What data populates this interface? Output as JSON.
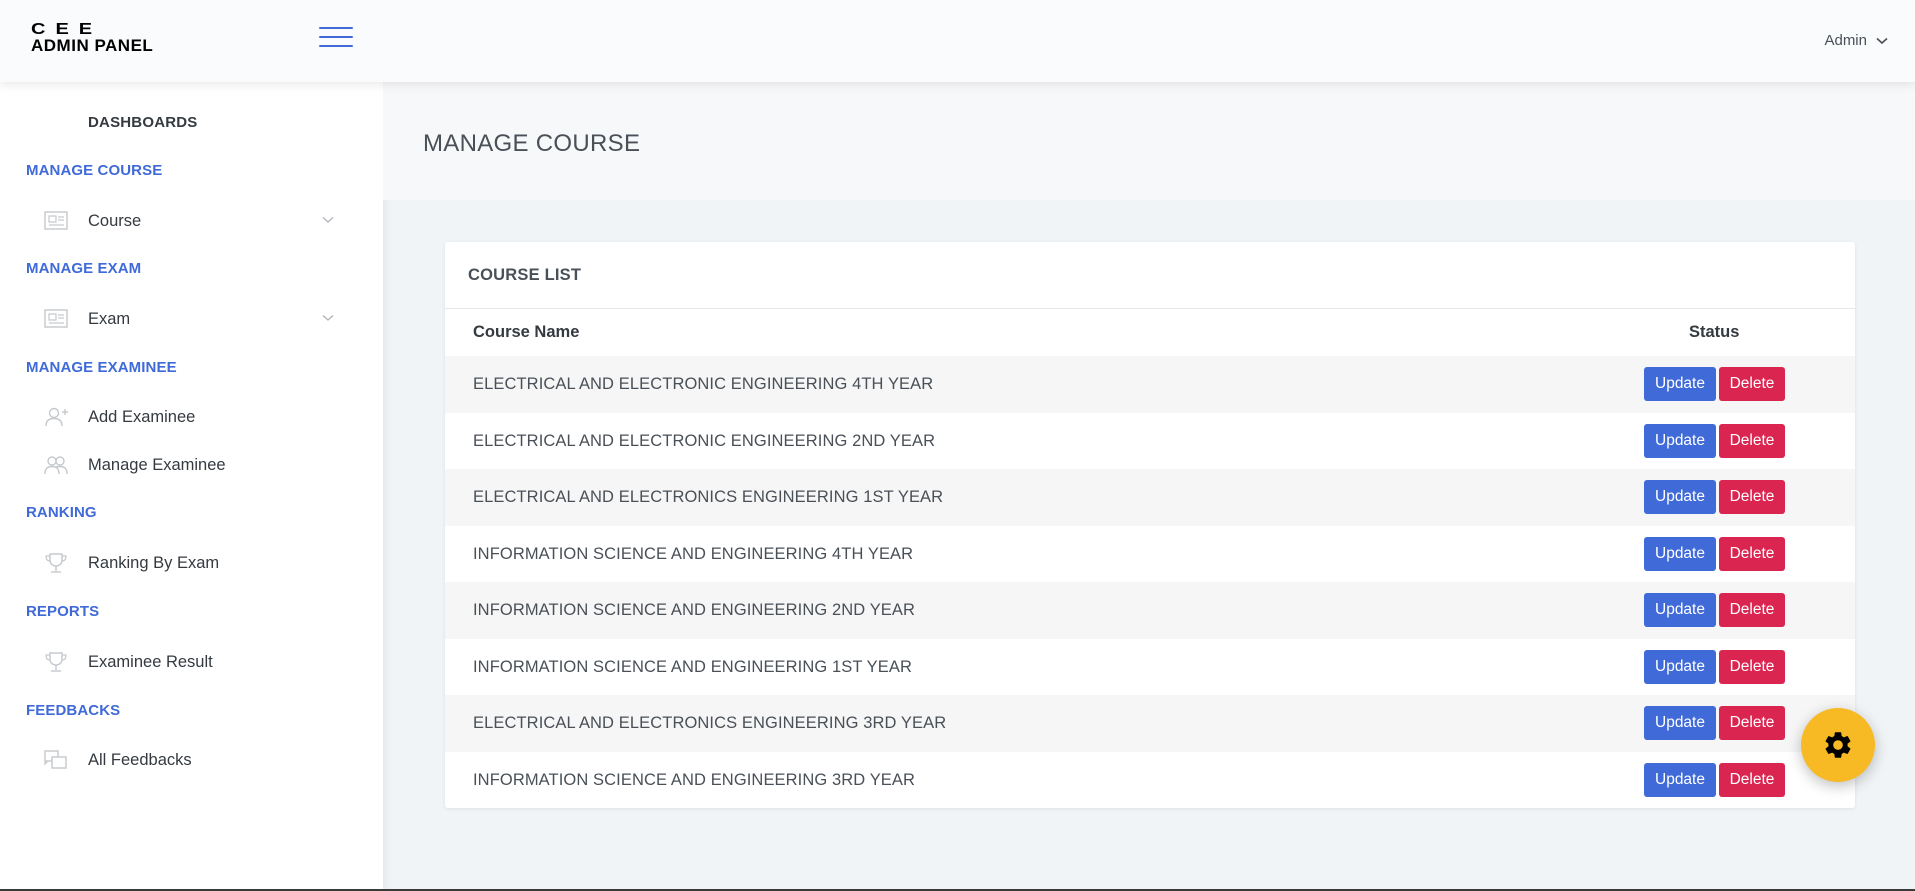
{
  "header": {
    "logo_top": "CEE",
    "logo_bottom": "ADMIN PANEL",
    "user_label": "Admin"
  },
  "sidebar": {
    "dashboards": "DASHBOARDS",
    "sections": [
      {
        "heading": "MANAGE COURSE",
        "items": [
          {
            "label": "Course",
            "icon": "course-icon",
            "has_chevron": true
          }
        ]
      },
      {
        "heading": "MANAGE EXAM",
        "items": [
          {
            "label": "Exam",
            "icon": "exam-icon",
            "has_chevron": true
          }
        ]
      },
      {
        "heading": "MANAGE EXAMINEE",
        "items": [
          {
            "label": "Add Examinee",
            "icon": "add-user-icon"
          },
          {
            "label": "Manage Examinee",
            "icon": "users-icon"
          }
        ]
      },
      {
        "heading": "RANKING",
        "items": [
          {
            "label": "Ranking By Exam",
            "icon": "trophy-icon"
          }
        ]
      },
      {
        "heading": "REPORTS",
        "items": [
          {
            "label": "Examinee Result",
            "icon": "trophy-icon"
          }
        ]
      },
      {
        "heading": "FEEDBACKS",
        "items": [
          {
            "label": "All Feedbacks",
            "icon": "feedback-icon"
          }
        ]
      }
    ]
  },
  "page": {
    "title": "MANAGE COURSE"
  },
  "course_list": {
    "title": "COURSE LIST",
    "columns": [
      "Course Name",
      "Status"
    ],
    "update_label": "Update",
    "delete_label": "Delete",
    "rows": [
      "ELECTRICAL AND ELECTRONIC ENGINEERING 4TH YEAR",
      "ELECTRICAL AND ELECTRONIC ENGINEERING 2ND YEAR",
      "ELECTRICAL AND ELECTRONICS ENGINEERING 1ST YEAR",
      "INFORMATION SCIENCE AND ENGINEERING 4TH YEAR",
      "INFORMATION SCIENCE AND ENGINEERING 2ND YEAR",
      "INFORMATION SCIENCE AND ENGINEERING 1ST YEAR",
      "ELECTRICAL AND ELECTRONICS ENGINEERING 3RD YEAR",
      "INFORMATION SCIENCE AND ENGINEERING 3RD YEAR"
    ]
  },
  "colors": {
    "primary": "#3f6ad8",
    "danger": "#d92550",
    "warning": "#f7b924"
  }
}
